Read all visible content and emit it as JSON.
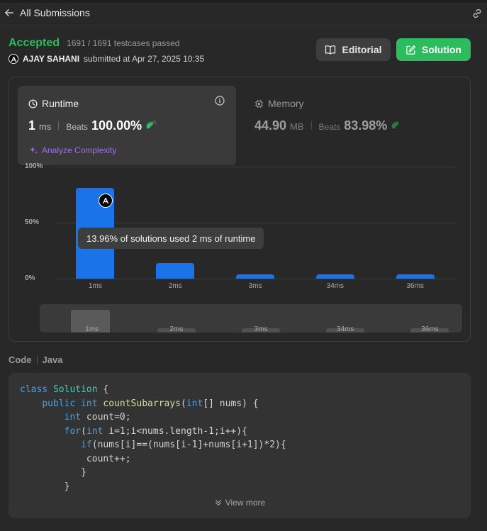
{
  "topbar": {
    "back_label": "All Submissions"
  },
  "submission": {
    "status": "Accepted",
    "testcases": "1691 / 1691 testcases passed",
    "user": "AJAY SAHANI",
    "submitted_text": "submitted at Apr 27, 2025 10:35"
  },
  "buttons": {
    "editorial": "Editorial",
    "solution": "Solution"
  },
  "runtime": {
    "title": "Runtime",
    "value": "1",
    "unit": "ms",
    "beats_label": "Beats",
    "beats_pct": "100.00%",
    "analyze": "Analyze Complexity"
  },
  "memory": {
    "title": "Memory",
    "value": "44.90",
    "unit": "MB",
    "beats_label": "Beats",
    "beats_pct": "83.98%"
  },
  "chart_data": {
    "type": "bar",
    "categories": [
      "1ms",
      "2ms",
      "3ms",
      "34ms",
      "36ms"
    ],
    "values": [
      81,
      13.96,
      3.5,
      3.5,
      3.5
    ],
    "ylim": [
      0,
      100
    ],
    "yticks": [
      "100%",
      "50%",
      "0%"
    ],
    "tooltip": "13.96% of solutions used 2 ms of runtime",
    "minimap_labels": [
      "1ms",
      "2ms",
      "3ms",
      "34ms",
      "36ms"
    ]
  },
  "code_section": {
    "label": "Code",
    "language": "Java",
    "view_more": "View more"
  },
  "colors": {
    "accepted": "#2cbb5d",
    "bar": "#1a73e8",
    "analyze": "#a06cf2"
  }
}
